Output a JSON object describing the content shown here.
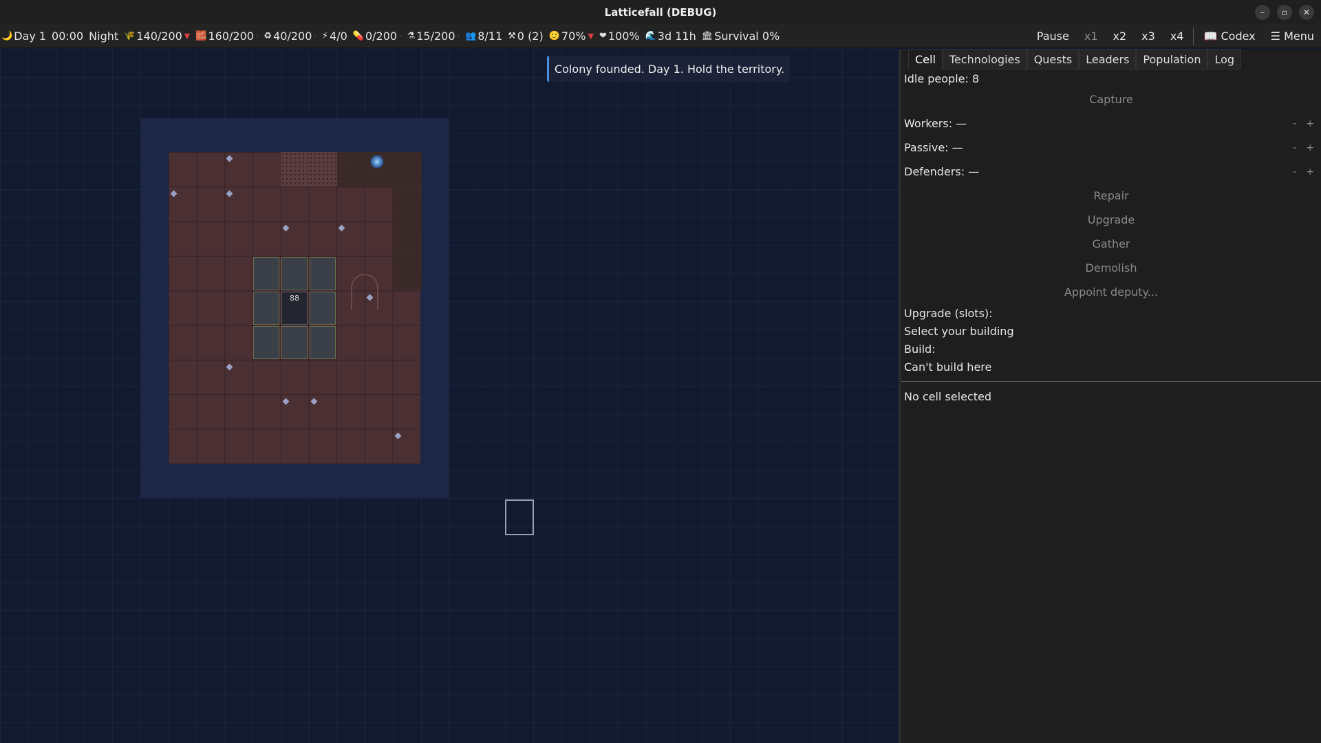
{
  "window": {
    "title": "Latticefall (DEBUG)"
  },
  "resources": [
    {
      "icon": "moon-icon",
      "glyph": "🌙",
      "text": "Day 1",
      "trend": ""
    },
    {
      "icon": "",
      "glyph": "",
      "text": "00:00",
      "trend": ""
    },
    {
      "icon": "",
      "glyph": "",
      "text": "Night",
      "trend": ""
    },
    {
      "icon": "wheat-icon",
      "glyph": "🌾",
      "text": "140/200",
      "trend": "▼"
    },
    {
      "icon": "brick-icon",
      "glyph": "🧱",
      "text": "160/200",
      "trend": "·"
    },
    {
      "icon": "recycle-icon",
      "glyph": "♻",
      "text": "40/200",
      "trend": "·"
    },
    {
      "icon": "lightning-icon",
      "glyph": "⚡",
      "text": "4/0",
      "trend": ""
    },
    {
      "icon": "pill-icon",
      "glyph": "💊",
      "text": "0/200",
      "trend": "·"
    },
    {
      "icon": "flask-icon",
      "glyph": "⚗",
      "text": "15/200",
      "trend": "·"
    },
    {
      "icon": "people-icon",
      "glyph": "👥",
      "text": "8/11",
      "trend": ""
    },
    {
      "icon": "tools-icon",
      "glyph": "⚒",
      "text": "0 (2)",
      "trend": ""
    },
    {
      "icon": "smile-icon",
      "glyph": "🙂",
      "text": "70%",
      "trend": "▼"
    },
    {
      "icon": "heart-icon",
      "glyph": "❤",
      "text": "100%",
      "trend": ""
    },
    {
      "icon": "wave-icon",
      "glyph": "🌊",
      "text": "3d 11h",
      "trend": ""
    },
    {
      "icon": "bank-icon",
      "glyph": "🏛",
      "text": "Survival 0%",
      "trend": ""
    }
  ],
  "speed": {
    "pause": "Pause",
    "x1": "x1",
    "x2": "x2",
    "x3": "x3",
    "x4": "x4"
  },
  "nav": {
    "codex": "📖 Codex",
    "menu": "☰ Menu"
  },
  "toast": "Colony founded. Day 1. Hold the territory.",
  "hq_label": "88",
  "panel": {
    "tabs": [
      "Cell",
      "Technologies",
      "Quests",
      "Leaders",
      "Population",
      "Log"
    ],
    "idle": "Idle people: 8",
    "capture": "Capture",
    "workers": "Workers: —",
    "passive": "Passive: —",
    "defenders": "Defenders: —",
    "minus": "-",
    "plus": "+",
    "repair": "Repair",
    "upgrade": "Upgrade",
    "gather": "Gather",
    "demolish": "Demolish",
    "appoint": "Appoint deputy...",
    "upgrade_slots": "Upgrade (slots):",
    "select_building": "Select your building",
    "build": "Build:",
    "cant_build": "Can't build here",
    "no_cell": "No cell selected"
  },
  "colors": {
    "accent": "#4a8fe0",
    "down": "#e04040",
    "ground": "#4a2f33",
    "territory": "#1c2747"
  }
}
